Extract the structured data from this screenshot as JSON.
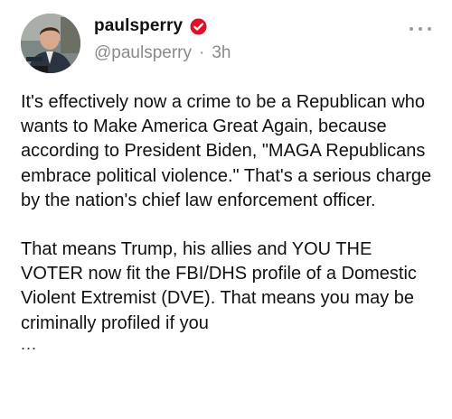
{
  "post": {
    "author": {
      "display_name": "paulsperry",
      "handle": "@paulsperry",
      "verified_icon": "verified-badge-icon",
      "avatar_icon": "profile-photo"
    },
    "time_separator": "·",
    "timestamp": "3h",
    "more_icon": "more-options-icon",
    "body": {
      "paragraph_1": "It's effectively now a crime to be a Republican who wants to Make America Great Again, because according to President Biden, \"MAGA Republicans embrace political violence.\" That's a serious charge by the nation's chief law enforcement officer.",
      "paragraph_2": "That means Trump, his allies and YOU THE VOTER now fit the FBI/DHS profile of a Domestic Violent Extremist (DVE). That means you may be criminally profiled if you",
      "truncation": "..."
    },
    "colors": {
      "text": "#111111",
      "meta": "#8a8a8a",
      "verified_badge": "#e0102a"
    }
  }
}
